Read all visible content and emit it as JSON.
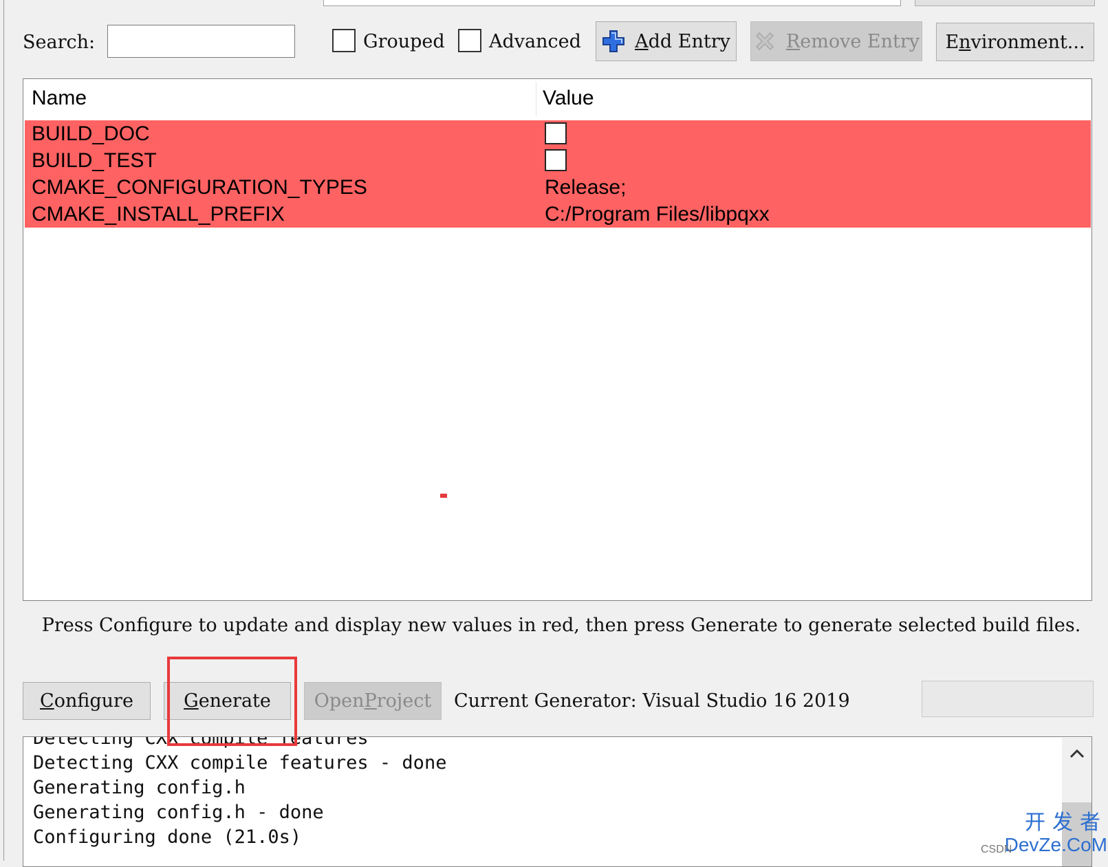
{
  "toolbar": {
    "search_label": "Search:",
    "search_value": "",
    "grouped_label": "Grouped",
    "grouped_checked": false,
    "advanced_label": "Advanced",
    "advanced_checked": false,
    "add_entry": {
      "mnemonic": "A",
      "rest": "dd Entry",
      "icon": "plus-icon"
    },
    "remove_entry": {
      "mnemonic": "R",
      "rest": "emove Entry",
      "icon": "remove-icon",
      "disabled": true
    },
    "environment": {
      "prefix": "E",
      "mnemonic": "n",
      "rest": "vironment..."
    }
  },
  "table": {
    "headers": {
      "name": "Name",
      "value": "Value"
    },
    "row_color": "#ff6262",
    "rows": [
      {
        "name": "BUILD_DOC",
        "type": "checkbox",
        "value": "",
        "checked": false
      },
      {
        "name": "BUILD_TEST",
        "type": "checkbox",
        "value": "",
        "checked": false
      },
      {
        "name": "CMAKE_CONFIGURATION_TYPES",
        "type": "text",
        "value": "Release;"
      },
      {
        "name": "CMAKE_INSTALL_PREFIX",
        "type": "text",
        "value": "C:/Program Files/libpqxx"
      }
    ]
  },
  "info_text": "Press Configure to update and display new values in red, then press Generate to generate selected build files.",
  "actions": {
    "configure": {
      "mnemonic": "C",
      "rest": "onfigure"
    },
    "generate": {
      "mnemonic": "G",
      "rest": "enerate"
    },
    "open_project": {
      "prefix": "Open ",
      "mnemonic": "P",
      "rest": "roject",
      "disabled": true
    },
    "current_generator": "Current Generator: Visual Studio 16 2019"
  },
  "log": {
    "lines": [
      "Detecting CXX compile features",
      "Detecting CXX compile features - done",
      "Generating config.h",
      "Generating config.h - done",
      "Configuring done (21.0s)"
    ]
  },
  "annotation": {
    "color": "#e8393a",
    "target": "generate-button"
  },
  "watermark": {
    "cn": "开发者",
    "en": "DevZe.CoM",
    "csdn": "CSDN"
  }
}
